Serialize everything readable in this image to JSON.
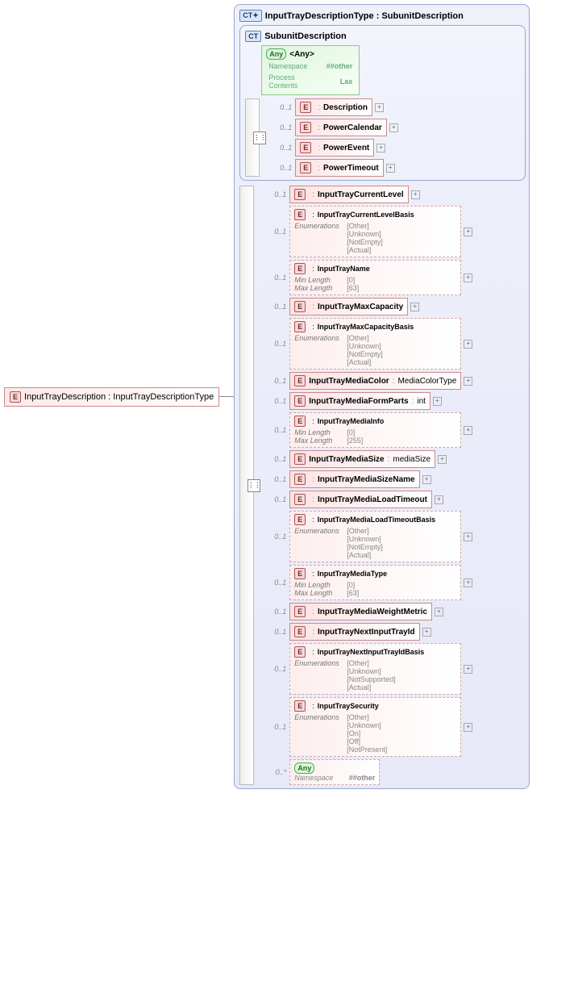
{
  "root": {
    "label": "InputTrayDescription",
    "type": "InputTrayDescriptionType"
  },
  "outer": {
    "title": "InputTrayDescriptionType",
    "base": "SubunitDescription"
  },
  "inner": {
    "title": "SubunitDescription"
  },
  "any": {
    "title": "<Any>",
    "ns_label": "Namespace",
    "ns_val": "##other",
    "pc_label": "Process Contents",
    "pc_val": "Lax"
  },
  "inner_items": [
    {
      "card": "0..1",
      "ref": "<Ref>",
      "name": "Description"
    },
    {
      "card": "0..1",
      "ref": "<Ref>",
      "name": "PowerCalendar"
    },
    {
      "card": "0..1",
      "ref": "<Ref>",
      "name": "PowerEvent"
    },
    {
      "card": "0..1",
      "ref": "<Ref>",
      "name": "PowerTimeout"
    }
  ],
  "outer_items": [
    {
      "card": "0..1",
      "ref": "<Ref>",
      "name": "InputTrayCurrentLevel",
      "kind": "simple"
    },
    {
      "card": "0..1",
      "ref": "<Ref>",
      "name": "InputTrayCurrentLevelBasis",
      "kind": "enum",
      "enums": [
        "[Other]",
        "[Unknown]",
        "[NotEmpty]",
        "[Actual]"
      ]
    },
    {
      "card": "0..1",
      "ref": "<Ref>",
      "name": "InputTrayName",
      "kind": "len",
      "min": "[0]",
      "max": "[63]"
    },
    {
      "card": "0..1",
      "ref": "<Ref>",
      "name": "InputTrayMaxCapacity",
      "kind": "simple"
    },
    {
      "card": "0..1",
      "ref": "<Ref>",
      "name": "InputTrayMaxCapacityBasis",
      "kind": "enum",
      "enums": [
        "[Other]",
        "[Unknown]",
        "[NotEmpty]",
        "[Actual]"
      ]
    },
    {
      "card": "0..1",
      "name": "InputTrayMediaColor",
      "type": "MediaColorType",
      "kind": "typed"
    },
    {
      "card": "0..1",
      "name": "InputTrayMediaFormParts",
      "type": "int",
      "kind": "typed"
    },
    {
      "card": "0..1",
      "ref": "<Ref>",
      "name": "InputTrayMediaInfo",
      "kind": "len",
      "min": "[0]",
      "max": "[255]"
    },
    {
      "card": "0..1",
      "name": "InputTrayMediaSize",
      "type": "mediaSize",
      "kind": "typed"
    },
    {
      "card": "0..1",
      "ref": "<Ref>",
      "name": "InputTrayMediaSizeName",
      "kind": "simple"
    },
    {
      "card": "0..1",
      "ref": "<Ref>",
      "name": "InputTrayMediaLoadTimeout",
      "kind": "simple"
    },
    {
      "card": "0..1",
      "ref": "<Ref>",
      "name": "InputTrayMediaLoadTimeoutBasis",
      "kind": "enum",
      "enums": [
        "[Other]",
        "[Unknown]",
        "[NotEmpty]",
        "[Actual]"
      ]
    },
    {
      "card": "0..1",
      "ref": "<Ref>",
      "name": "InputTrayMediaType",
      "kind": "len",
      "min": "[0]",
      "max": "[63]"
    },
    {
      "card": "0..1",
      "ref": "<Ref>",
      "name": "InputTrayMediaWeightMetric",
      "kind": "simple"
    },
    {
      "card": "0..1",
      "ref": "<Ref>",
      "name": "InputTrayNextInputTrayId",
      "kind": "simple"
    },
    {
      "card": "0..1",
      "ref": "<Ref>",
      "name": "InputTrayNextInputTrayIdBasis",
      "kind": "enum",
      "enums": [
        "[Other]",
        "[Unknown]",
        "[NotSupported]",
        "[Actual]"
      ]
    },
    {
      "card": "0..1",
      "ref": "<Ref>",
      "name": "InputTraySecurity",
      "kind": "enum",
      "enums": [
        "[Other]",
        "[Unknown]",
        "[On]",
        "[Off]",
        "[NotPresent]"
      ]
    }
  ],
  "outer_any": {
    "card": "0..*",
    "title": "<Any>",
    "ns_label": "Namespace",
    "ns_val": "##other"
  },
  "labels": {
    "enum": "Enumerations",
    "minlen": "Min Length",
    "maxlen": "Max Length",
    "ref_sep": ":"
  }
}
